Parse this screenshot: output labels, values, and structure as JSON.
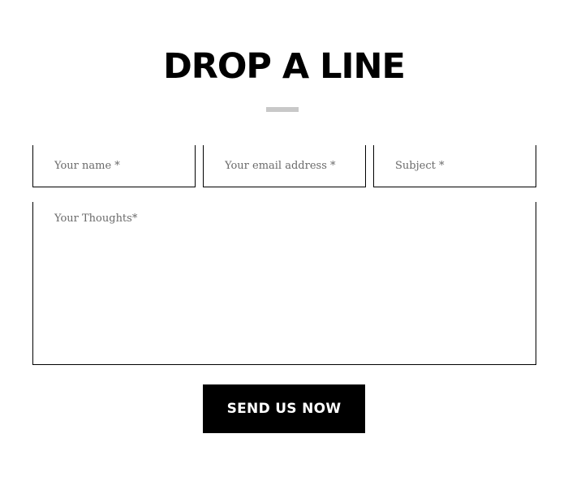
{
  "heading": "DROP A LINE",
  "form": {
    "name": {
      "value": "",
      "placeholder": "Your name *"
    },
    "email": {
      "value": "",
      "placeholder": "Your email address *"
    },
    "subject": {
      "value": "",
      "placeholder": "Subject *"
    },
    "message": {
      "value": "",
      "placeholder": "Your Thoughts*"
    },
    "submit_label": "SEND US NOW"
  },
  "colors": {
    "text": "#000000",
    "background": "#ffffff",
    "divider": "#c8c8c8",
    "button_bg": "#000000",
    "button_text": "#ffffff",
    "placeholder": "#6a6a6a"
  }
}
